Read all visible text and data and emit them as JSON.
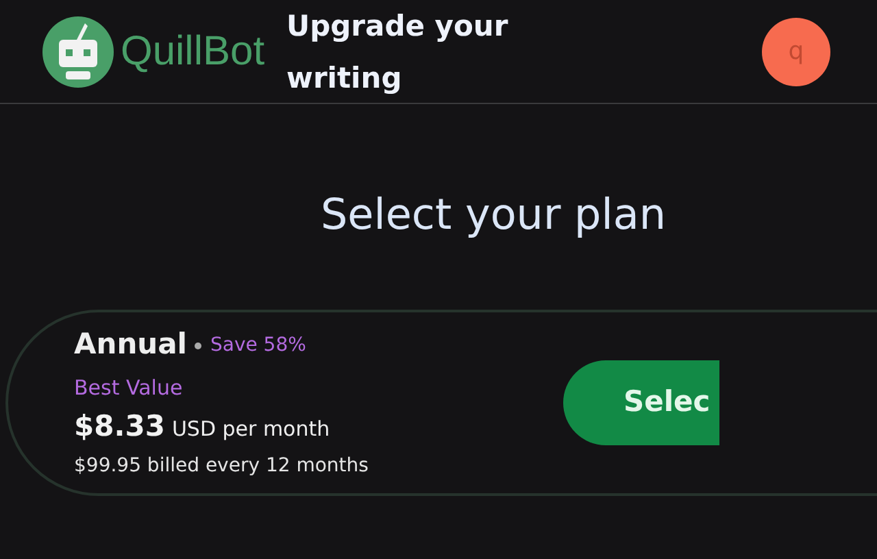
{
  "header": {
    "logo_text": "QuillBot",
    "tagline": "Upgrade your writing",
    "avatar_letter": "q"
  },
  "title": "Select your plan",
  "plan": {
    "name": "Annual",
    "savings": "Save 58%",
    "badge": "Best Value",
    "price": "$8.33",
    "price_unit": "USD per month",
    "billing": "$99.95 billed every 12 months",
    "button": "Selec"
  }
}
